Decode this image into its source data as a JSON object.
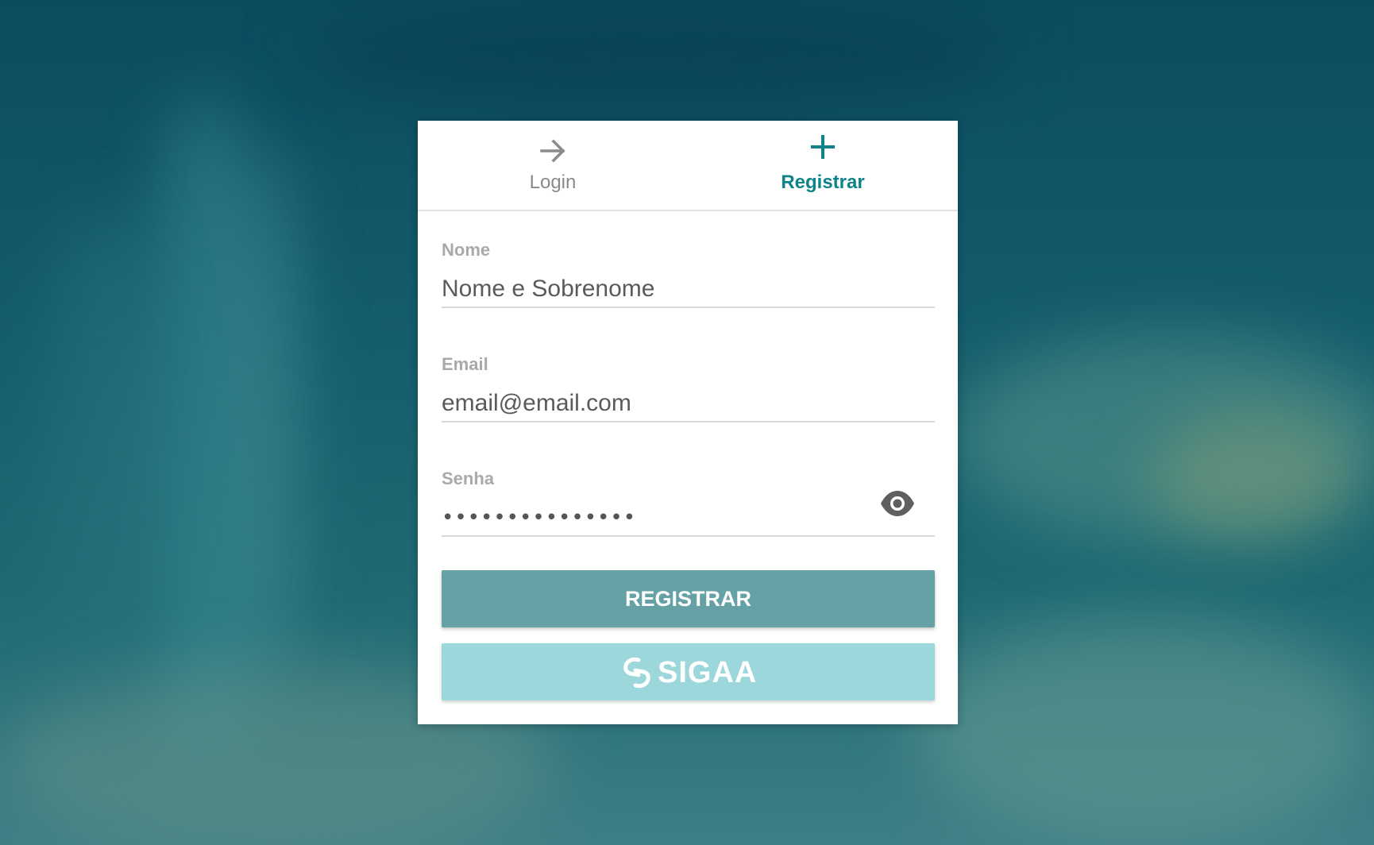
{
  "tabs": [
    {
      "label": "Login",
      "icon": "arrow-right-icon",
      "active": false
    },
    {
      "label": "Registrar",
      "icon": "plus-icon",
      "active": true
    }
  ],
  "form": {
    "nome": {
      "label": "Nome",
      "placeholder": "Nome e Sobrenome"
    },
    "email": {
      "label": "Email",
      "placeholder": "email@email.com"
    },
    "senha": {
      "label": "Senha",
      "value": "•••••••••••••••",
      "icon": "eye-icon"
    }
  },
  "buttons": {
    "register_label": "REGISTRAR",
    "sigaa_label": "SIGAA",
    "sigaa_icon": "sigaa-logo-icon"
  },
  "colors": {
    "accent": "#0e8388",
    "register_button": "#66a2a5",
    "sigaa_button": "#9cd8db",
    "inactive_tab": "#8a8a8a",
    "field_label": "#a9a9a9"
  }
}
